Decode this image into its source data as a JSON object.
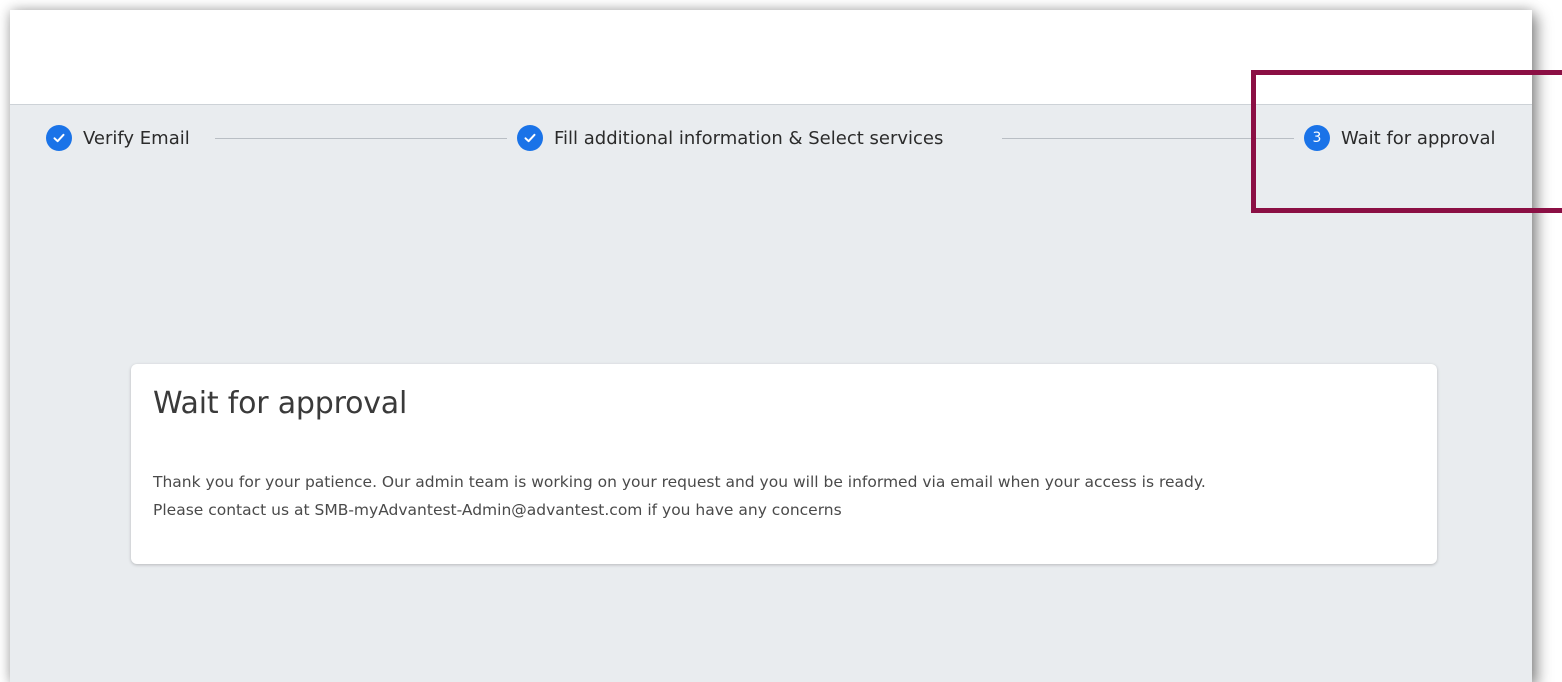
{
  "stepper": {
    "steps": [
      {
        "label": "Verify Email",
        "state": "completed",
        "icon": "check-icon"
      },
      {
        "label": "Fill additional information & Select services",
        "state": "completed",
        "icon": "check-icon"
      },
      {
        "label": "Wait for approval",
        "state": "active",
        "number": "3"
      }
    ]
  },
  "card": {
    "title": "Wait for approval",
    "line1": "Thank you for your patience. Our admin team is working on your request and you will be informed via email when your access is ready.",
    "line2": "Please contact us at SMB-myAdvantest-Admin@advantest.com if you have any concerns"
  },
  "colors": {
    "step_accent": "#1a73e8",
    "content_background": "#e9ecef",
    "highlight_border": "#8b0f44"
  }
}
